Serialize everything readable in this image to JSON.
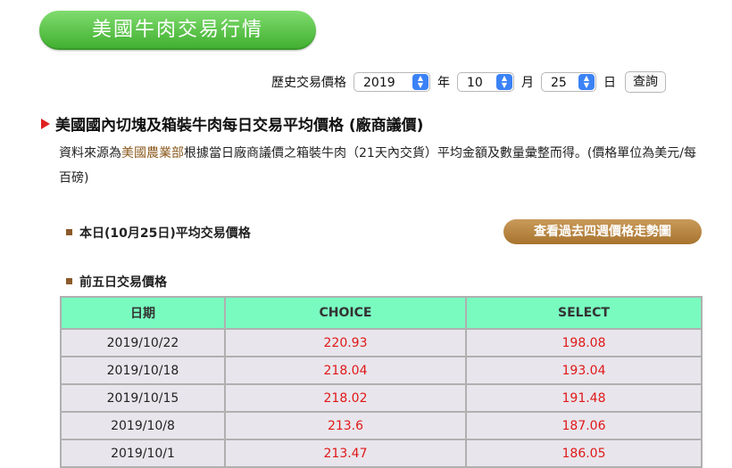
{
  "header": {
    "title": "美國牛肉交易行情"
  },
  "query": {
    "label": "歷史交易價格",
    "year": "2019",
    "year_unit": "年",
    "month": "10",
    "month_unit": "月",
    "day": "25",
    "day_unit": "日",
    "button": "查詢"
  },
  "section": {
    "title": "美國國內切塊及箱裝牛肉每日交易平均價格 (廠商議價)",
    "desc_prefix": "資料來源為",
    "desc_link": "美國農業部",
    "desc_suffix": "根據當日廠商議價之箱裝牛肉（21天內交貨）平均金額及數量彙整而得。(價格單位為美元/每百磅)"
  },
  "today": {
    "heading": "本日(10月25日)平均交易價格",
    "trend_button": "查看過去四週價格走勢圖"
  },
  "history": {
    "heading": "前五日交易價格",
    "columns": [
      "日期",
      "CHOICE",
      "SELECT"
    ],
    "rows": [
      {
        "date": "2019/10/22",
        "choice": "220.93",
        "select": "198.08"
      },
      {
        "date": "2019/10/18",
        "choice": "218.04",
        "select": "193.04"
      },
      {
        "date": "2019/10/15",
        "choice": "218.02",
        "select": "191.48"
      },
      {
        "date": "2019/10/8",
        "choice": "213.6",
        "select": "187.06"
      },
      {
        "date": "2019/10/1",
        "choice": "213.47",
        "select": "186.05"
      }
    ]
  },
  "colors": {
    "title_green": "#4cba3a",
    "table_header": "#79fbc0",
    "price_red": "#e01818",
    "trend_button": "#b9843f"
  }
}
